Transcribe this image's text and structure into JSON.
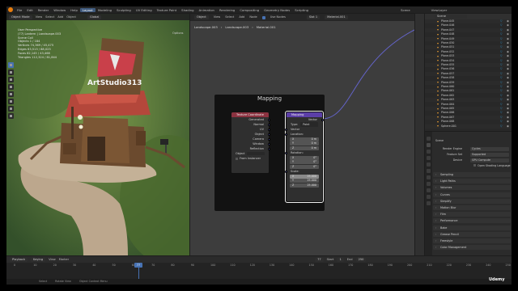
{
  "topbar": {
    "menus": [
      "File",
      "Edit",
      "Render",
      "Window",
      "Help"
    ],
    "workspaces": [
      "Layout",
      "Modeling",
      "Sculpting",
      "UV Editing",
      "Texture Paint",
      "Shading",
      "Animation",
      "Rendering",
      "Compositing",
      "Geometry Nodes",
      "Scripting"
    ],
    "active_workspace": "Layout",
    "scene": "Scene",
    "view_layer": "ViewLayer"
  },
  "viewport": {
    "mode": "Object Mode",
    "menus": [
      "View",
      "Select",
      "Add",
      "Object"
    ],
    "transform": "Global",
    "options": "Options",
    "stats": {
      "line1": "User Perspective",
      "line2": "(77) Lantern | Landscape.003",
      "line3": "Scene Coll",
      "line4": "Objects          1 / 184",
      "line5": "Vertices  74,369 / 45,475",
      "line6": "Edges      63,513 / 88,023",
      "line7": "Faces       82,145 / 43,468",
      "line8": "Triangles  112,324 / 81,844"
    },
    "sign_text": "ArtStudio313"
  },
  "node_editor": {
    "header": {
      "mode": "Object",
      "menus": [
        "View",
        "Select",
        "Add",
        "Node"
      ],
      "use_nodes": "Use Nodes",
      "slot": "Slot 1",
      "material": "Material.001"
    },
    "breadcrumb": [
      "Landscape.003",
      "Landscape.003",
      "Material.001"
    ],
    "frame_label": "Mapping",
    "texcoord": {
      "title": "Texture Coordinate",
      "outputs": [
        "Generated",
        "Normal",
        "UV",
        "Object",
        "Camera",
        "Window",
        "Reflection"
      ],
      "object_label": "Object",
      "from_instancer": "From Instancer"
    },
    "mapping": {
      "title": "Mapping",
      "output": "Vector",
      "type_label": "Type:",
      "type_value": "Point",
      "vector": "Vector",
      "location": "Location:",
      "location_values": [
        "0 m",
        "0 m",
        "0 m"
      ],
      "rotation": "Rotation:",
      "rotation_values": [
        "0°",
        "0°",
        "0°"
      ],
      "scale": "Scale:",
      "scale_values": [
        "25.000",
        "25.000",
        "25.000"
      ],
      "axes": [
        "X",
        "Y",
        "Z"
      ]
    }
  },
  "outliner": {
    "search": "Scene",
    "items": [
      "Plane.045",
      "Plane.046",
      "Plane.047",
      "Plane.048",
      "Plane.049",
      "Plane.050",
      "Plane.051",
      "Plane.052",
      "Plane.053",
      "Plane.054",
      "Plane.055",
      "Plane.056",
      "Plane.057",
      "Plane.058",
      "Plane.059",
      "Plane.060",
      "Plane.061",
      "Plane.062",
      "Plane.063",
      "Plane.064",
      "Plane.065",
      "Plane.066",
      "Plane.067",
      "Plane.068",
      "Sphere.001"
    ]
  },
  "properties": {
    "scene_label": "Scene",
    "render_engine_label": "Render Engine",
    "render_engine": "Cycles",
    "feature_set_label": "Feature Set",
    "feature_set": "Supported",
    "device_label": "Device",
    "device": "GPU Compute",
    "osl_label": "Open Shading Language",
    "sections": [
      "Sampling",
      "Light Paths",
      "Volumes",
      "Curves",
      "Simplify",
      "Motion Blur",
      "Film",
      "Performance",
      "Bake",
      "Grease Pencil",
      "Freestyle",
      "Color Management"
    ]
  },
  "timeline": {
    "menus": [
      "Playback",
      "Keying",
      "View",
      "Marker"
    ],
    "current_frame": "77",
    "start_label": "Start",
    "start": "1",
    "end_label": "End",
    "end": "250",
    "ticks": [
      "0",
      "10",
      "20",
      "30",
      "40",
      "50",
      "60",
      "70",
      "80",
      "90",
      "100",
      "110",
      "120",
      "130",
      "140",
      "150",
      "160",
      "170",
      "180",
      "190",
      "200",
      "210",
      "220",
      "230",
      "240",
      "250"
    ]
  },
  "statusbar": [
    "Select",
    "Rotate View",
    "Object Context Menu"
  ],
  "watermark": "Udemy"
}
